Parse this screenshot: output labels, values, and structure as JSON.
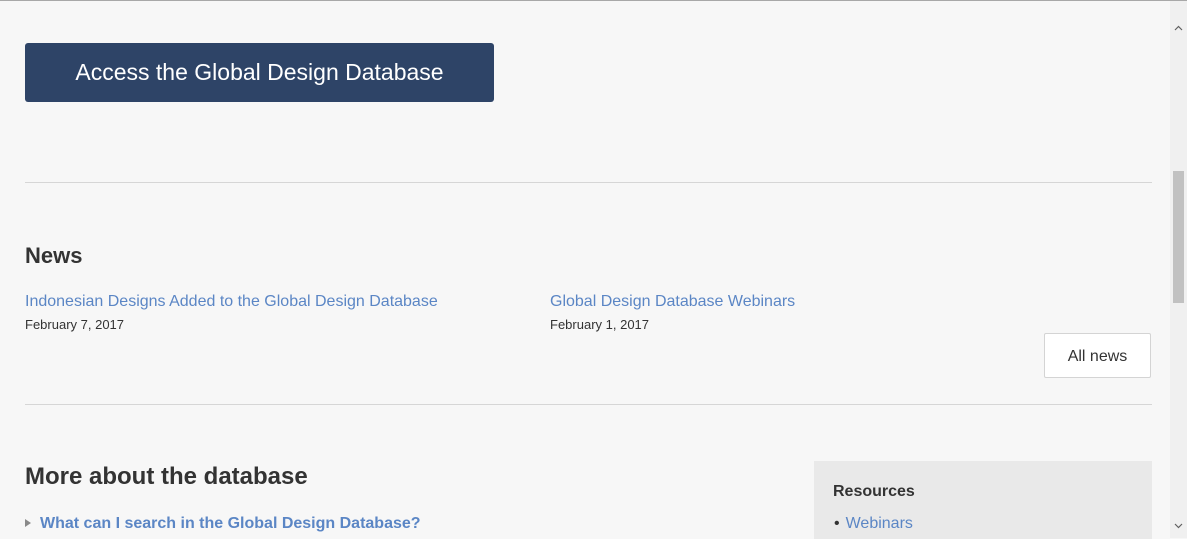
{
  "access_button": {
    "label": "Access the Global Design Database"
  },
  "news": {
    "title": "News",
    "items": [
      {
        "title": "Indonesian Designs Added to the Global Design Database",
        "date": "February 7, 2017"
      },
      {
        "title": "Global Design Database Webinars",
        "date": "February 1, 2017"
      }
    ],
    "all_news_label": "All news"
  },
  "more": {
    "title": "More about the database",
    "faq_item": "What can I search in the Global Design Database?"
  },
  "resources": {
    "title": "Resources",
    "items": [
      "Webinars"
    ]
  },
  "colors": {
    "button_bg": "#2e4467",
    "link": "#5b86c5",
    "text": "#333333",
    "page_bg": "#f7f7f7",
    "resources_bg": "#e9e9e9"
  },
  "icons": {
    "expand": "triangle-right-icon",
    "scroll_up": "chevron-up-icon",
    "scroll_down": "chevron-down-icon"
  }
}
